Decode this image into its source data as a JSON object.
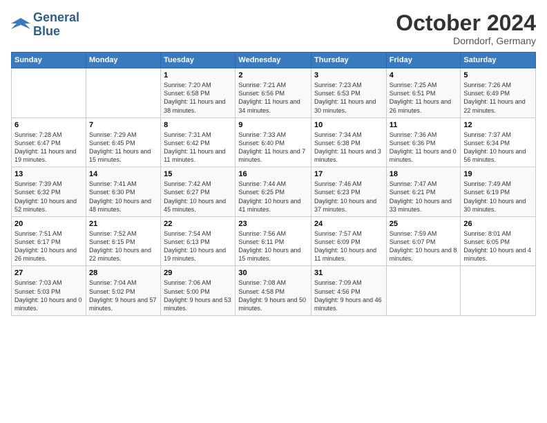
{
  "logo": {
    "line1": "General",
    "line2": "Blue"
  },
  "title": "October 2024",
  "location": "Dorndorf, Germany",
  "days_of_week": [
    "Sunday",
    "Monday",
    "Tuesday",
    "Wednesday",
    "Thursday",
    "Friday",
    "Saturday"
  ],
  "weeks": [
    [
      {
        "day": "",
        "info": ""
      },
      {
        "day": "",
        "info": ""
      },
      {
        "day": "1",
        "info": "Sunrise: 7:20 AM\nSunset: 6:58 PM\nDaylight: 11 hours and 38 minutes."
      },
      {
        "day": "2",
        "info": "Sunrise: 7:21 AM\nSunset: 6:56 PM\nDaylight: 11 hours and 34 minutes."
      },
      {
        "day": "3",
        "info": "Sunrise: 7:23 AM\nSunset: 6:53 PM\nDaylight: 11 hours and 30 minutes."
      },
      {
        "day": "4",
        "info": "Sunrise: 7:25 AM\nSunset: 6:51 PM\nDaylight: 11 hours and 26 minutes."
      },
      {
        "day": "5",
        "info": "Sunrise: 7:26 AM\nSunset: 6:49 PM\nDaylight: 11 hours and 22 minutes."
      }
    ],
    [
      {
        "day": "6",
        "info": "Sunrise: 7:28 AM\nSunset: 6:47 PM\nDaylight: 11 hours and 19 minutes."
      },
      {
        "day": "7",
        "info": "Sunrise: 7:29 AM\nSunset: 6:45 PM\nDaylight: 11 hours and 15 minutes."
      },
      {
        "day": "8",
        "info": "Sunrise: 7:31 AM\nSunset: 6:42 PM\nDaylight: 11 hours and 11 minutes."
      },
      {
        "day": "9",
        "info": "Sunrise: 7:33 AM\nSunset: 6:40 PM\nDaylight: 11 hours and 7 minutes."
      },
      {
        "day": "10",
        "info": "Sunrise: 7:34 AM\nSunset: 6:38 PM\nDaylight: 11 hours and 3 minutes."
      },
      {
        "day": "11",
        "info": "Sunrise: 7:36 AM\nSunset: 6:36 PM\nDaylight: 11 hours and 0 minutes."
      },
      {
        "day": "12",
        "info": "Sunrise: 7:37 AM\nSunset: 6:34 PM\nDaylight: 10 hours and 56 minutes."
      }
    ],
    [
      {
        "day": "13",
        "info": "Sunrise: 7:39 AM\nSunset: 6:32 PM\nDaylight: 10 hours and 52 minutes."
      },
      {
        "day": "14",
        "info": "Sunrise: 7:41 AM\nSunset: 6:30 PM\nDaylight: 10 hours and 48 minutes."
      },
      {
        "day": "15",
        "info": "Sunrise: 7:42 AM\nSunset: 6:27 PM\nDaylight: 10 hours and 45 minutes."
      },
      {
        "day": "16",
        "info": "Sunrise: 7:44 AM\nSunset: 6:25 PM\nDaylight: 10 hours and 41 minutes."
      },
      {
        "day": "17",
        "info": "Sunrise: 7:46 AM\nSunset: 6:23 PM\nDaylight: 10 hours and 37 minutes."
      },
      {
        "day": "18",
        "info": "Sunrise: 7:47 AM\nSunset: 6:21 PM\nDaylight: 10 hours and 33 minutes."
      },
      {
        "day": "19",
        "info": "Sunrise: 7:49 AM\nSunset: 6:19 PM\nDaylight: 10 hours and 30 minutes."
      }
    ],
    [
      {
        "day": "20",
        "info": "Sunrise: 7:51 AM\nSunset: 6:17 PM\nDaylight: 10 hours and 26 minutes."
      },
      {
        "day": "21",
        "info": "Sunrise: 7:52 AM\nSunset: 6:15 PM\nDaylight: 10 hours and 22 minutes."
      },
      {
        "day": "22",
        "info": "Sunrise: 7:54 AM\nSunset: 6:13 PM\nDaylight: 10 hours and 19 minutes."
      },
      {
        "day": "23",
        "info": "Sunrise: 7:56 AM\nSunset: 6:11 PM\nDaylight: 10 hours and 15 minutes."
      },
      {
        "day": "24",
        "info": "Sunrise: 7:57 AM\nSunset: 6:09 PM\nDaylight: 10 hours and 11 minutes."
      },
      {
        "day": "25",
        "info": "Sunrise: 7:59 AM\nSunset: 6:07 PM\nDaylight: 10 hours and 8 minutes."
      },
      {
        "day": "26",
        "info": "Sunrise: 8:01 AM\nSunset: 6:05 PM\nDaylight: 10 hours and 4 minutes."
      }
    ],
    [
      {
        "day": "27",
        "info": "Sunrise: 7:03 AM\nSunset: 5:03 PM\nDaylight: 10 hours and 0 minutes."
      },
      {
        "day": "28",
        "info": "Sunrise: 7:04 AM\nSunset: 5:02 PM\nDaylight: 9 hours and 57 minutes."
      },
      {
        "day": "29",
        "info": "Sunrise: 7:06 AM\nSunset: 5:00 PM\nDaylight: 9 hours and 53 minutes."
      },
      {
        "day": "30",
        "info": "Sunrise: 7:08 AM\nSunset: 4:58 PM\nDaylight: 9 hours and 50 minutes."
      },
      {
        "day": "31",
        "info": "Sunrise: 7:09 AM\nSunset: 4:56 PM\nDaylight: 9 hours and 46 minutes."
      },
      {
        "day": "",
        "info": ""
      },
      {
        "day": "",
        "info": ""
      }
    ]
  ]
}
